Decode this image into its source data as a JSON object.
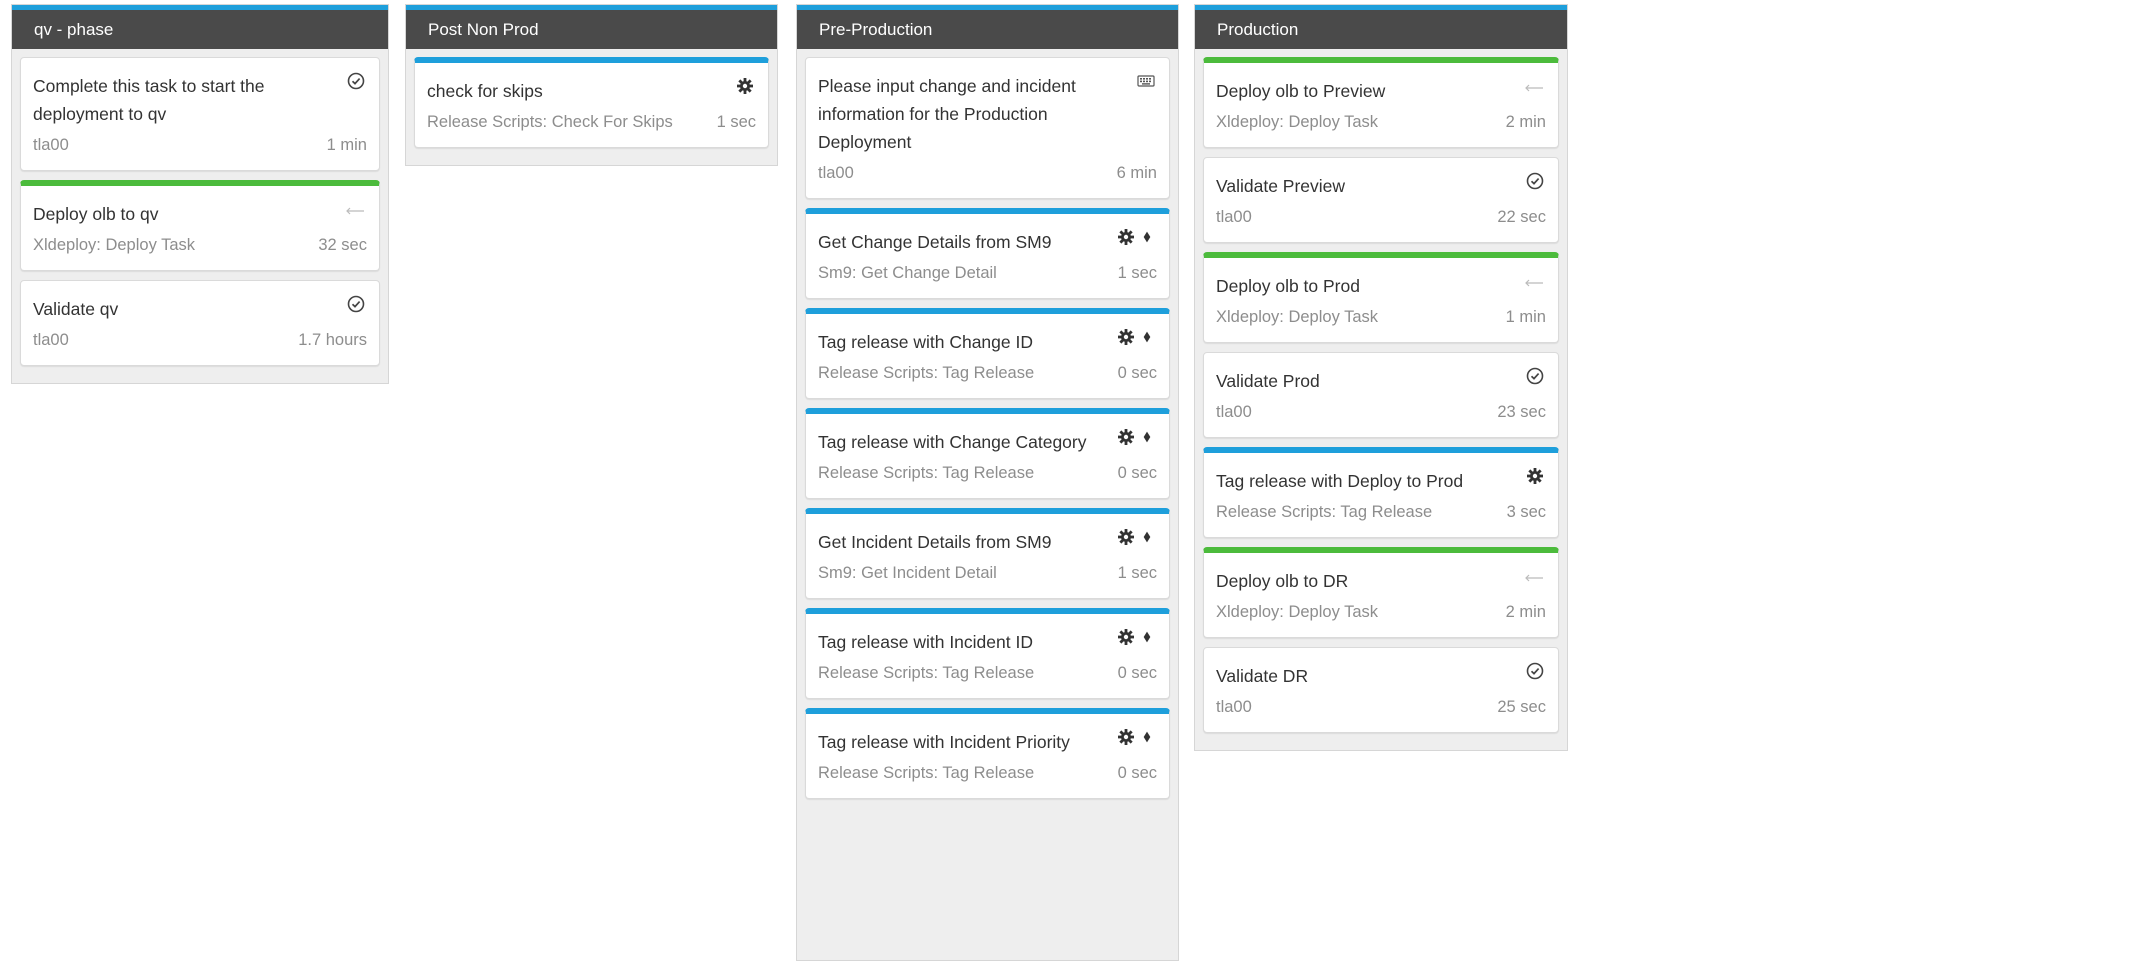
{
  "colors": {
    "header_bg": "#4a4a4a",
    "accent_blue": "#1e9fdb",
    "status_green": "#4cbb3c",
    "column_bg": "#eeeeee"
  },
  "phases": [
    {
      "title": "qv - phase",
      "tasks": [
        {
          "title": "Complete this task to start the deployment to qv",
          "subtitle": "tla00",
          "duration": "1 min",
          "icon": "check-circle-icon"
        },
        {
          "title": "Deploy olb to qv",
          "subtitle": "Xldeploy: Deploy Task",
          "duration": "32 sec",
          "icon": "arrow-left-icon"
        },
        {
          "title": "Validate qv",
          "subtitle": "tla00",
          "duration": "1.7 hours",
          "icon": "check-circle-icon"
        }
      ]
    },
    {
      "title": "Post Non Prod",
      "tasks": [
        {
          "title": "check for skips",
          "subtitle": "Release Scripts: Check For Skips",
          "duration": "1 sec",
          "icon": "gear-icon"
        }
      ]
    },
    {
      "title": "Pre-Production",
      "tasks": [
        {
          "title": "Please input change and incident information for the Production Deployment",
          "subtitle": "tla00",
          "duration": "6 min",
          "icon": "keyboard-icon"
        },
        {
          "title": "Get Change Details from SM9",
          "subtitle": "Sm9: Get Change Detail",
          "duration": "1 sec",
          "icon": "gear-diamond-icon"
        },
        {
          "title": "Tag release with Change ID",
          "subtitle": "Release Scripts: Tag Release",
          "duration": "0 sec",
          "icon": "gear-diamond-icon"
        },
        {
          "title": "Tag release with Change Category",
          "subtitle": "Release Scripts: Tag Release",
          "duration": "0 sec",
          "icon": "gear-diamond-icon"
        },
        {
          "title": "Get Incident Details from SM9",
          "subtitle": "Sm9: Get Incident Detail",
          "duration": "1 sec",
          "icon": "gear-diamond-icon"
        },
        {
          "title": "Tag release with Incident ID",
          "subtitle": "Release Scripts: Tag Release",
          "duration": "0 sec",
          "icon": "gear-diamond-icon"
        },
        {
          "title": "Tag release with Incident Priority",
          "subtitle": "Release Scripts: Tag Release",
          "duration": "0 sec",
          "icon": "gear-diamond-icon"
        }
      ]
    },
    {
      "title": "Production",
      "tasks": [
        {
          "title": "Deploy olb to Preview",
          "subtitle": "Xldeploy: Deploy Task",
          "duration": "2 min",
          "icon": "arrow-left-icon"
        },
        {
          "title": "Validate Preview",
          "subtitle": "tla00",
          "duration": "22 sec",
          "icon": "check-circle-icon"
        },
        {
          "title": "Deploy olb to Prod",
          "subtitle": "Xldeploy: Deploy Task",
          "duration": "1 min",
          "icon": "arrow-left-icon"
        },
        {
          "title": "Validate Prod",
          "subtitle": "tla00",
          "duration": "23 sec",
          "icon": "check-circle-icon"
        },
        {
          "title": "Tag release with Deploy to Prod",
          "subtitle": "Release Scripts: Tag Release",
          "duration": "3 sec",
          "icon": "gear-icon"
        },
        {
          "title": "Deploy olb to DR",
          "subtitle": "Xldeploy: Deploy Task",
          "duration": "2 min",
          "icon": "arrow-left-icon"
        },
        {
          "title": "Validate DR",
          "subtitle": "tla00",
          "duration": "25 sec",
          "icon": "check-circle-icon"
        }
      ]
    }
  ]
}
